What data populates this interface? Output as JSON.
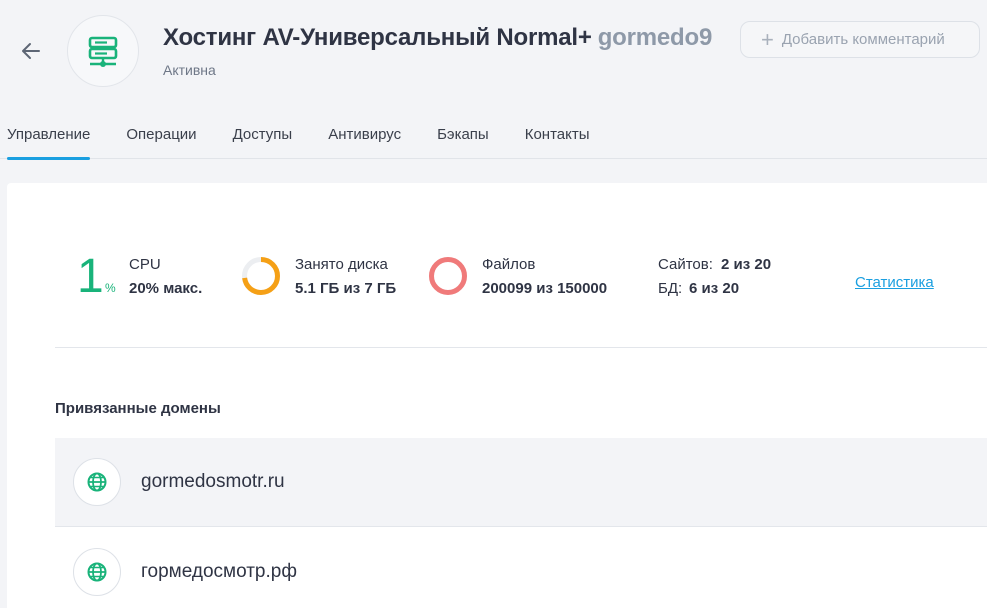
{
  "header": {
    "title": "Хостинг AV-Универсальный Normal+",
    "username": "gormedo9",
    "status": "Активна",
    "comment_button_label": "Добавить комментарий",
    "back_icon": "arrow-left-icon",
    "logo_icon": "server-icon"
  },
  "tabs": [
    {
      "label": "Управление",
      "active": true
    },
    {
      "label": "Операции",
      "active": false
    },
    {
      "label": "Доступы",
      "active": false
    },
    {
      "label": "Антивирус",
      "active": false
    },
    {
      "label": "Бэкапы",
      "active": false
    },
    {
      "label": "Контакты",
      "active": false
    }
  ],
  "stats": {
    "cpu": {
      "value": "1",
      "unit": "%",
      "label": "CPU",
      "max": "20% макс."
    },
    "disk": {
      "label": "Занято диска",
      "value": "5.1 ГБ из 7 ГБ",
      "fraction": 0.73
    },
    "files": {
      "label": "Файлов",
      "value": "200099 из 150000",
      "fraction": 1.0
    },
    "sites": {
      "label": "Сайтов:",
      "value": "2 из 20"
    },
    "db": {
      "label": "БД:",
      "value": "6 из 20"
    },
    "link": "Статистика"
  },
  "domains": {
    "title": "Привязанные домены",
    "items": [
      "gormedosmotr.ru",
      "гормедосмотр.рф"
    ]
  },
  "colors": {
    "accent": "#1a9fe0",
    "green": "#19b37a",
    "orange": "#f5a016",
    "red": "#f07a7a"
  }
}
